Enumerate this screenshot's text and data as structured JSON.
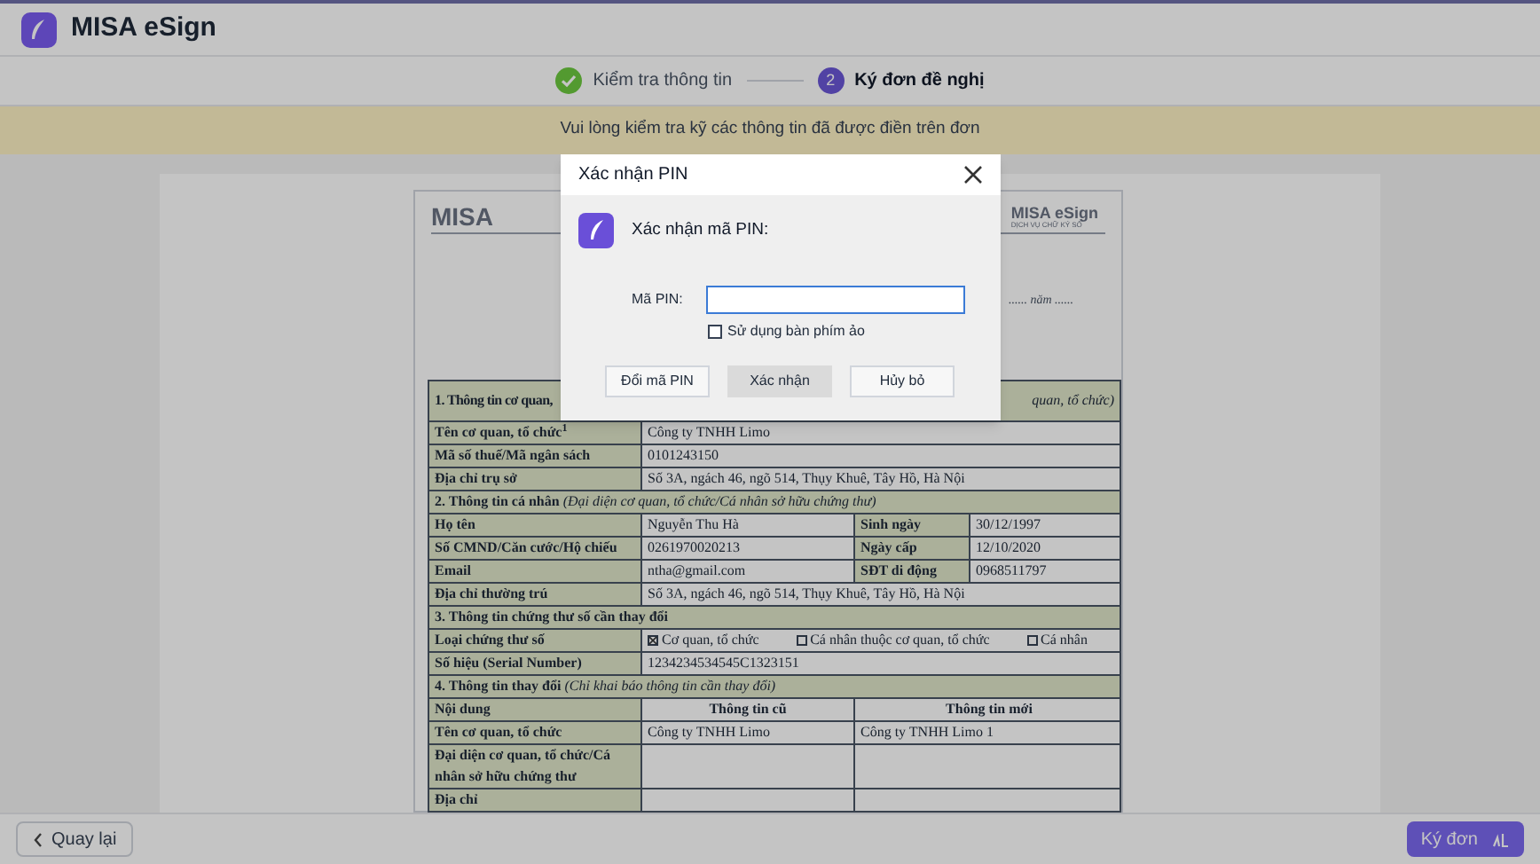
{
  "header": {
    "app_name": "MISA eSign"
  },
  "steps": [
    {
      "kind": "done",
      "label": "Kiểm tra thông tin"
    },
    {
      "kind": "current",
      "number": "2",
      "label": "Ký đơn đề nghị"
    }
  ],
  "banner": {
    "text": "Vui lòng kiểm tra kỹ các thông tin đã được điền trên đơn"
  },
  "document": {
    "logo_text": "MISA",
    "brand": "MISA eSign",
    "brand_sub": "DỊCH VỤ CHỮ KÝ SỐ",
    "date_text": "...... năm ......",
    "rows": [
      {
        "kind": "split",
        "left": "1. Thông tin cơ quan,",
        "right": "quan, tổ chức)"
      },
      {
        "kind": "pair",
        "cells": [
          "Tên cơ quan, tổ chức$^{1}$",
          "Công ty TNHH Limo"
        ]
      },
      {
        "kind": "pair",
        "cells": [
          "Mã số thuế/Mã ngân sách",
          "0101243150"
        ]
      },
      {
        "kind": "pair",
        "cells": [
          "Địa chỉ trụ sở",
          "Số 3A, ngách 46, ngõ 514, Thụy Khuê, Tây Hồ, Hà Nội"
        ]
      },
      {
        "kind": "section",
        "text": "**2. Thông tin cá nhân** *(Đại diện cơ quan, tổ chức/Cá nhân sở hữu chứng thư)*"
      },
      {
        "kind": "quad",
        "cells": [
          "Họ tên",
          "Nguyễn Thu Hà",
          "Sinh ngày",
          "30/12/1997"
        ]
      },
      {
        "kind": "quad",
        "cells": [
          "Số CMND/Căn cước/Hộ chiếu",
          "0261970020213",
          "Ngày cấp",
          "12/10/2020"
        ]
      },
      {
        "kind": "quad",
        "cells": [
          "Email",
          "ntha@gmail.com",
          "SĐT di động",
          "0968511797"
        ]
      },
      {
        "kind": "pair",
        "cells": [
          "Địa chỉ thường trú",
          "Số 3A, ngách 46, ngõ 514, Thụy Khuê, Tây Hồ, Hà Nội"
        ]
      },
      {
        "kind": "section",
        "text": "**3. Thông tin chứng thư số cần thay đổi**"
      },
      {
        "kind": "options",
        "label": "Loại chứng thư số",
        "options": [
          {
            "label": "Cơ quan, tổ chức",
            "checked": true
          },
          {
            "label": "Cá nhân thuộc cơ quan, tổ chức",
            "checked": false
          },
          {
            "label": "Cá nhân",
            "checked": false
          }
        ]
      },
      {
        "kind": "pair",
        "cells": [
          "Số hiệu (Serial Number)",
          "1234234534545C1323151"
        ]
      },
      {
        "kind": "section",
        "text": "**4. Thông tin thay đổi** *(Chỉ khai báo thông tin cần thay đổi)*"
      },
      {
        "kind": "heading",
        "cells": [
          "Nội dung",
          "Thông tin cũ",
          "Thông tin mới"
        ]
      },
      {
        "kind": "triple",
        "cells": [
          "Tên cơ quan, tổ chức",
          "Công ty TNHH Limo",
          "Công ty TNHH Limo 1"
        ]
      },
      {
        "kind": "triple",
        "cells": [
          "Đại diện cơ quan, tổ chức/Cá nhân sở hữu chứng thư"
        ]
      },
      {
        "kind": "triple",
        "cells": [
          "Địa chỉ"
        ]
      }
    ]
  },
  "dialog": {
    "title": "Xác nhận PIN",
    "heading": "Xác nhận mã PIN:",
    "pin_label": "Mã PIN:",
    "checkbox": {
      "label": "Sử dụng bàn phím ảo",
      "checked": false
    },
    "buttons": [
      {
        "label": "Đổi mã PIN",
        "focused": false
      },
      {
        "label": "Xác nhận",
        "focused": true
      },
      {
        "label": "Hủy bỏ",
        "focused": false
      }
    ]
  },
  "footer": {
    "back_label": "Quay lại",
    "sign_label": "Ký đơn"
  }
}
